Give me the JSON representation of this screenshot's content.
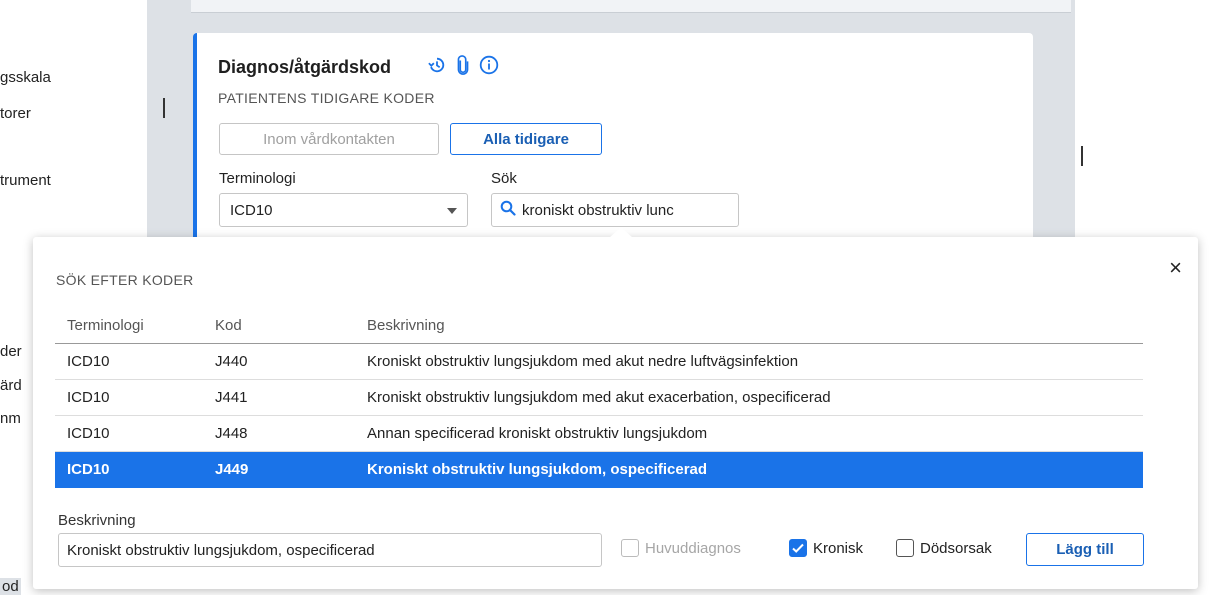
{
  "sidebar": {
    "fragments": [
      "gsskala",
      "torer",
      "trument",
      "der",
      "ärd",
      "nm",
      "od"
    ]
  },
  "card": {
    "title": "Diagnos/åtgärdskod",
    "subtitle": "PATIENTENS TIDIGARE KODER",
    "icons": [
      "history-icon",
      "attachment-icon",
      "info-icon"
    ],
    "filter_buttons": {
      "within_contact": "Inom vårdkontakten",
      "all_previous": "Alla tidigare"
    },
    "terminology_label": "Terminologi",
    "terminology_value": "ICD10",
    "search_label": "Sök",
    "search_value": "kroniskt obstruktiv lunc"
  },
  "popover": {
    "title": "SÖK EFTER KODER",
    "close_label": "×",
    "columns": [
      "Terminologi",
      "Kod",
      "Beskrivning"
    ],
    "rows": [
      {
        "terminology": "ICD10",
        "code": "J440",
        "description": "Kroniskt obstruktiv lungsjukdom med akut nedre luftvägsinfektion"
      },
      {
        "terminology": "ICD10",
        "code": "J441",
        "description": "Kroniskt obstruktiv lungsjukdom med akut exacerbation, ospecificerad"
      },
      {
        "terminology": "ICD10",
        "code": "J448",
        "description": "Annan specificerad kroniskt obstruktiv lungsjukdom"
      },
      {
        "terminology": "ICD10",
        "code": "J449",
        "description": "Kroniskt obstruktiv lungsjukdom, ospecificerad",
        "selected": true
      }
    ],
    "description_label": "Beskrivning",
    "description_value": "Kroniskt obstruktiv lungsjukdom, ospecificerad",
    "checkboxes": {
      "main_diagnosis": "Huvuddiagnos",
      "chronic": "Kronisk",
      "cause_of_death": "Dödsorsak"
    },
    "add_button": "Lägg till"
  },
  "colors": {
    "accent": "#1a73e8",
    "panel_gray": "#dde1e6"
  }
}
